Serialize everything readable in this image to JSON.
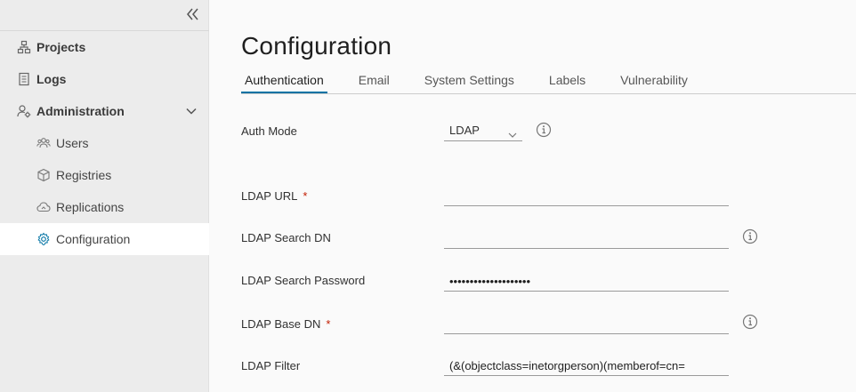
{
  "sidebar": {
    "items": [
      {
        "label": "Projects",
        "icon": "projects-icon"
      },
      {
        "label": "Logs",
        "icon": "logs-icon"
      },
      {
        "label": "Administration",
        "icon": "administration-icon"
      }
    ],
    "sub_items": [
      {
        "label": "Users",
        "icon": "users-icon"
      },
      {
        "label": "Registries",
        "icon": "registries-icon"
      },
      {
        "label": "Replications",
        "icon": "replications-icon"
      },
      {
        "label": "Configuration",
        "icon": "gear-icon",
        "active": true
      }
    ]
  },
  "main": {
    "title": "Configuration",
    "tabs": [
      {
        "label": "Authentication",
        "active": true
      },
      {
        "label": "Email"
      },
      {
        "label": "System Settings"
      },
      {
        "label": "Labels"
      },
      {
        "label": "Vulnerability"
      }
    ],
    "form": {
      "auth_mode": {
        "label": "Auth Mode",
        "value": "LDAP"
      },
      "ldap_url": {
        "label": "LDAP URL",
        "required": "*",
        "value": ""
      },
      "ldap_search_dn": {
        "label": "LDAP Search DN",
        "value": ""
      },
      "ldap_search_password": {
        "label": "LDAP Search Password",
        "value": "••••••••••••••••••••"
      },
      "ldap_base_dn": {
        "label": "LDAP Base DN",
        "required": "*",
        "value": ""
      },
      "ldap_filter": {
        "label": "LDAP Filter",
        "value": "(&(objectclass=inetorgperson)(memberof=cn="
      }
    }
  },
  "colors": {
    "accent": "#0072a3",
    "sidebar_bg": "#ececec",
    "main_bg": "#fafafa",
    "required": "#c21d00"
  }
}
